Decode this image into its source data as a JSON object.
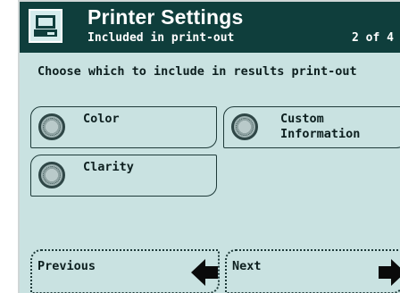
{
  "header": {
    "icon": "printer-icon",
    "title": "Printer Settings",
    "subtitle": "Included in print-out",
    "page_count": "2 of 4"
  },
  "instruction": "Choose which to include in results print-out",
  "options": [
    {
      "label": "Color"
    },
    {
      "label": "Custom\nInformation"
    },
    {
      "label": "Clarity"
    }
  ],
  "nav": {
    "previous_label": "Previous",
    "previous_icon": "arrow-left-icon",
    "next_label": "Next",
    "next_icon": "arrow-right-icon"
  },
  "colors": {
    "header_bg": "#0f3e3c",
    "screen_bg": "#c9e2e1",
    "text": "#0d1f1f"
  }
}
